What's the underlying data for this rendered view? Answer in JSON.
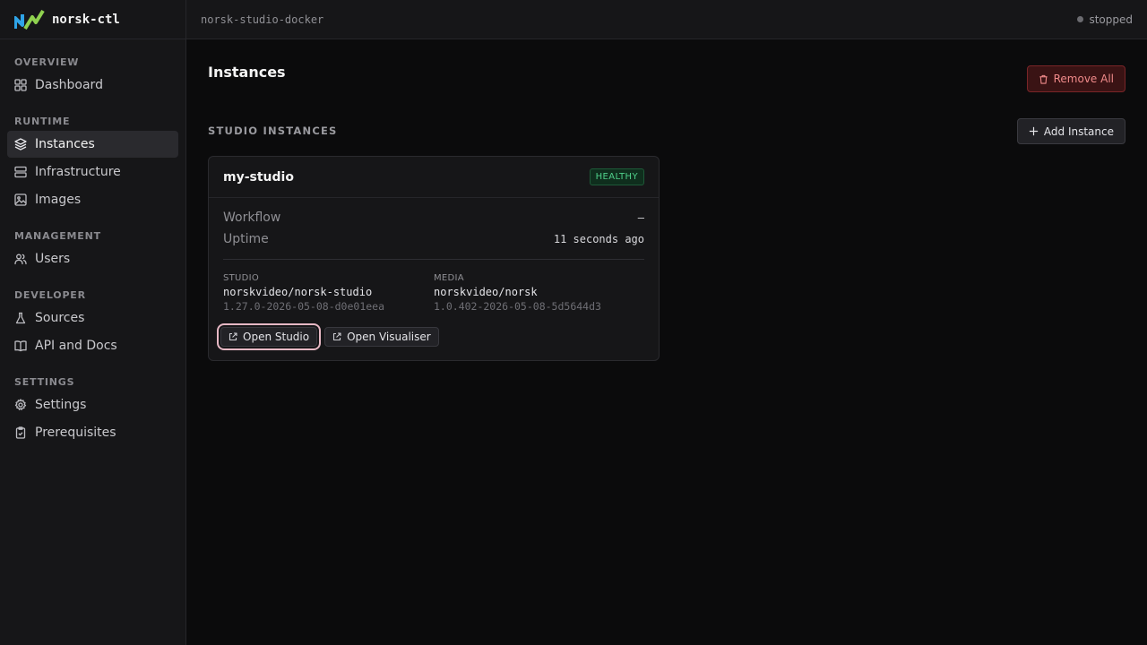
{
  "app": {
    "name": "norsk-ctl"
  },
  "sidebar": {
    "sections": [
      {
        "title": "OVERVIEW",
        "items": [
          {
            "label": "Dashboard",
            "icon": "grid-icon"
          }
        ]
      },
      {
        "title": "RUNTIME",
        "items": [
          {
            "label": "Instances",
            "icon": "layers-icon",
            "active": true
          },
          {
            "label": "Infrastructure",
            "icon": "server-icon"
          },
          {
            "label": "Images",
            "icon": "image-icon"
          }
        ]
      },
      {
        "title": "MANAGEMENT",
        "items": [
          {
            "label": "Users",
            "icon": "users-icon"
          }
        ]
      },
      {
        "title": "DEVELOPER",
        "items": [
          {
            "label": "Sources",
            "icon": "flask-icon"
          },
          {
            "label": "API and Docs",
            "icon": "book-icon"
          }
        ]
      },
      {
        "title": "SETTINGS",
        "items": [
          {
            "label": "Settings",
            "icon": "gear-icon"
          },
          {
            "label": "Prerequisites",
            "icon": "clipboard-icon"
          }
        ]
      }
    ]
  },
  "topbar": {
    "context": "norsk-studio-docker",
    "status": "stopped"
  },
  "page": {
    "title": "Instances",
    "remove_all_label": "Remove All",
    "section_title": "STUDIO INSTANCES",
    "add_instance_label": "Add Instance"
  },
  "instance": {
    "name": "my-studio",
    "health": "HEALTHY",
    "workflow_label": "Workflow",
    "workflow_value": "–",
    "uptime_label": "Uptime",
    "uptime_value": "11 seconds ago",
    "studio_label": "STUDIO",
    "studio_image": "norskvideo/norsk-studio",
    "studio_version": "1.27.0-2026-05-08-d0e01eea",
    "media_label": "MEDIA",
    "media_image": "norskvideo/norsk",
    "media_version": "1.0.402-2026-05-08-5d5644d3",
    "open_studio_label": "Open Studio",
    "open_visualiser_label": "Open Visualiser"
  },
  "colors": {
    "accent_blue": "#2fa4e7",
    "accent_green": "#8fd14f",
    "healthy": "#4fcf8a",
    "danger": "#f08a8a"
  }
}
